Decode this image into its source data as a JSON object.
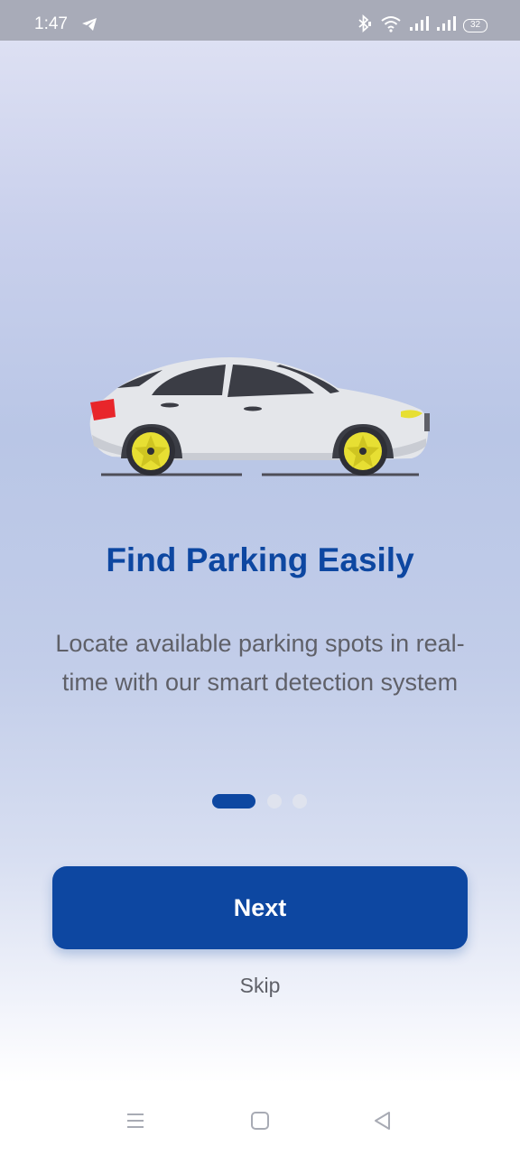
{
  "status_bar": {
    "time": "1:47",
    "battery": "32",
    "icons": [
      "telegram-send-icon",
      "bluetooth-icon",
      "wifi-icon",
      "signal-icon",
      "signal-icon",
      "battery-icon"
    ]
  },
  "onboarding": {
    "title": "Find Parking Easily",
    "description": "Locate available parking spots in real-time with our smart detection system",
    "page_indicator": {
      "current": 1,
      "total": 3
    },
    "next_label": "Next",
    "skip_label": "Skip"
  },
  "nav_bar": {
    "icons": [
      "menu-icon",
      "home-icon",
      "back-icon"
    ]
  },
  "colors": {
    "primary": "#0d47a1",
    "text_secondary": "#5f6068",
    "status_bar": "#a8abb8",
    "car_body": "#e4e6ea",
    "wheel_rim": "#e7df33",
    "tail_light": "#e8262b"
  }
}
